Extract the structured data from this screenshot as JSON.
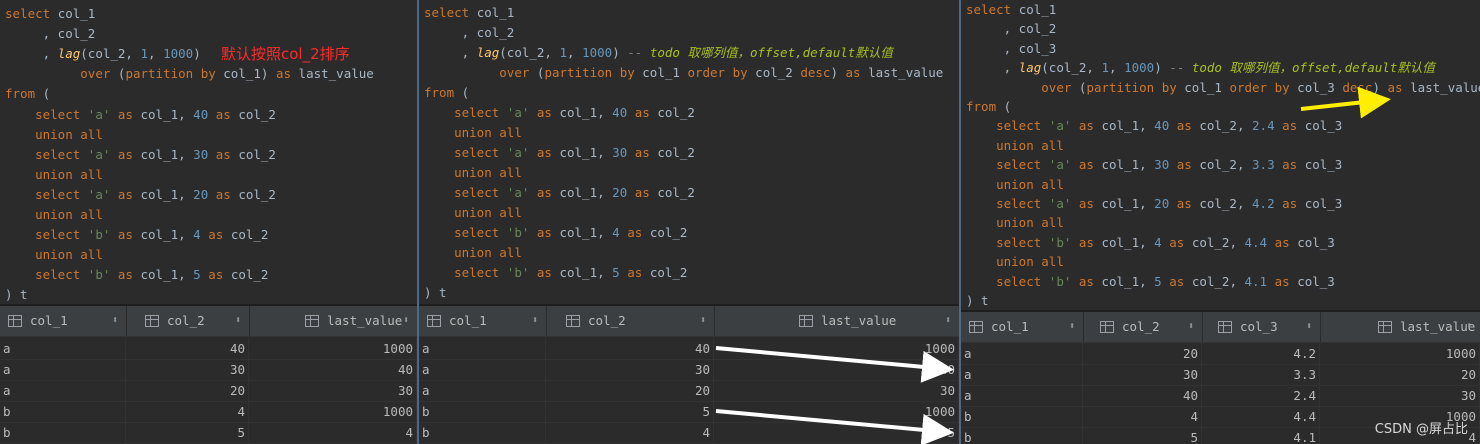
{
  "panels": [
    {
      "code": [
        [
          [
            "kw",
            "select "
          ],
          [
            "t",
            "col_1"
          ]
        ],
        [
          [
            "t",
            "     , col_2"
          ]
        ],
        [
          [
            "t",
            "     , "
          ],
          [
            "fn",
            "lag"
          ],
          [
            "t",
            "(col_2, "
          ],
          [
            "num",
            "1"
          ],
          [
            "t",
            ", "
          ],
          [
            "num",
            "1000"
          ],
          [
            "t",
            ")"
          ]
        ],
        [
          [
            "t",
            "          "
          ],
          [
            "kw",
            "over "
          ],
          [
            "t",
            "("
          ],
          [
            "kw",
            "partition by "
          ],
          [
            "t",
            "col_1) "
          ],
          [
            "kw",
            "as "
          ],
          [
            "t",
            "last_value"
          ]
        ],
        [
          [
            "kw",
            "from "
          ],
          [
            "t",
            "("
          ]
        ],
        [
          [
            "t",
            "    "
          ],
          [
            "kw",
            "select "
          ],
          [
            "str",
            "'a' "
          ],
          [
            "kw",
            "as "
          ],
          [
            "t",
            "col_1, "
          ],
          [
            "num",
            "40 "
          ],
          [
            "kw",
            "as "
          ],
          [
            "t",
            "col_2"
          ]
        ],
        [
          [
            "t",
            "    "
          ],
          [
            "kw",
            "union all"
          ]
        ],
        [
          [
            "t",
            "    "
          ],
          [
            "kw",
            "select "
          ],
          [
            "str",
            "'a' "
          ],
          [
            "kw",
            "as "
          ],
          [
            "t",
            "col_1, "
          ],
          [
            "num",
            "30 "
          ],
          [
            "kw",
            "as "
          ],
          [
            "t",
            "col_2"
          ]
        ],
        [
          [
            "t",
            "    "
          ],
          [
            "kw",
            "union all"
          ]
        ],
        [
          [
            "t",
            "    "
          ],
          [
            "kw",
            "select "
          ],
          [
            "str",
            "'a' "
          ],
          [
            "kw",
            "as "
          ],
          [
            "t",
            "col_1, "
          ],
          [
            "num",
            "20 "
          ],
          [
            "kw",
            "as "
          ],
          [
            "t",
            "col_2"
          ]
        ],
        [
          [
            "t",
            "    "
          ],
          [
            "kw",
            "union all"
          ]
        ],
        [
          [
            "t",
            "    "
          ],
          [
            "kw",
            "select "
          ],
          [
            "str",
            "'b' "
          ],
          [
            "kw",
            "as "
          ],
          [
            "t",
            "col_1, "
          ],
          [
            "num",
            "4 "
          ],
          [
            "kw",
            "as "
          ],
          [
            "t",
            "col_2"
          ]
        ],
        [
          [
            "t",
            "    "
          ],
          [
            "kw",
            "union all"
          ]
        ],
        [
          [
            "t",
            "    "
          ],
          [
            "kw",
            "select "
          ],
          [
            "str",
            "'b' "
          ],
          [
            "kw",
            "as "
          ],
          [
            "t",
            "col_1, "
          ],
          [
            "num",
            "5 "
          ],
          [
            "kw",
            "as "
          ],
          [
            "t",
            "col_2"
          ]
        ],
        [
          [
            "t",
            ") t"
          ]
        ]
      ],
      "note": "默认按照col_2排序",
      "grid": {
        "columns": [
          "col_1",
          "col_2",
          "last_value"
        ],
        "rows": [
          [
            "a",
            "40",
            "1000"
          ],
          [
            "a",
            "30",
            "40"
          ],
          [
            "a",
            "20",
            "30"
          ],
          [
            "b",
            "4",
            "1000"
          ],
          [
            "b",
            "5",
            "4"
          ]
        ]
      }
    },
    {
      "code": [
        [
          [
            "kw",
            "select "
          ],
          [
            "t",
            "col_1"
          ]
        ],
        [
          [
            "t",
            "     , col_2"
          ]
        ],
        [
          [
            "t",
            "     , "
          ],
          [
            "fn",
            "lag"
          ],
          [
            "t",
            "(col_2, "
          ],
          [
            "num",
            "1"
          ],
          [
            "t",
            ", "
          ],
          [
            "num",
            "1000"
          ],
          [
            "t",
            ") "
          ],
          [
            "cmt",
            "-- "
          ],
          [
            "todo",
            "todo 取哪列值，offset,default默认值"
          ]
        ],
        [
          [
            "t",
            "          "
          ],
          [
            "kw",
            "over "
          ],
          [
            "t",
            "("
          ],
          [
            "kw",
            "partition by "
          ],
          [
            "t",
            "col_1 "
          ],
          [
            "kw",
            "order by "
          ],
          [
            "t",
            "col_2 "
          ],
          [
            "kw",
            "desc"
          ],
          [
            "t",
            ") "
          ],
          [
            "kw",
            "as "
          ],
          [
            "t",
            "last_value"
          ]
        ],
        [
          [
            "kw",
            "from "
          ],
          [
            "t",
            "("
          ]
        ],
        [
          [
            "t",
            "    "
          ],
          [
            "kw",
            "select "
          ],
          [
            "str",
            "'a' "
          ],
          [
            "kw",
            "as "
          ],
          [
            "t",
            "col_1, "
          ],
          [
            "num",
            "40 "
          ],
          [
            "kw",
            "as "
          ],
          [
            "t",
            "col_2"
          ]
        ],
        [
          [
            "t",
            "    "
          ],
          [
            "kw",
            "union all"
          ]
        ],
        [
          [
            "t",
            "    "
          ],
          [
            "kw",
            "select "
          ],
          [
            "str",
            "'a' "
          ],
          [
            "kw",
            "as "
          ],
          [
            "t",
            "col_1, "
          ],
          [
            "num",
            "30 "
          ],
          [
            "kw",
            "as "
          ],
          [
            "t",
            "col_2"
          ]
        ],
        [
          [
            "t",
            "    "
          ],
          [
            "kw",
            "union all"
          ]
        ],
        [
          [
            "t",
            "    "
          ],
          [
            "kw",
            "select "
          ],
          [
            "str",
            "'a' "
          ],
          [
            "kw",
            "as "
          ],
          [
            "t",
            "col_1, "
          ],
          [
            "num",
            "20 "
          ],
          [
            "kw",
            "as "
          ],
          [
            "t",
            "col_2"
          ]
        ],
        [
          [
            "t",
            "    "
          ],
          [
            "kw",
            "union all"
          ]
        ],
        [
          [
            "t",
            "    "
          ],
          [
            "kw",
            "select "
          ],
          [
            "str",
            "'b' "
          ],
          [
            "kw",
            "as "
          ],
          [
            "t",
            "col_1, "
          ],
          [
            "num",
            "4 "
          ],
          [
            "kw",
            "as "
          ],
          [
            "t",
            "col_2"
          ]
        ],
        [
          [
            "t",
            "    "
          ],
          [
            "kw",
            "union all"
          ]
        ],
        [
          [
            "t",
            "    "
          ],
          [
            "kw",
            "select "
          ],
          [
            "str",
            "'b' "
          ],
          [
            "kw",
            "as "
          ],
          [
            "t",
            "col_1, "
          ],
          [
            "num",
            "5 "
          ],
          [
            "kw",
            "as "
          ],
          [
            "t",
            "col_2"
          ]
        ],
        [
          [
            "t",
            ") t"
          ]
        ]
      ],
      "grid": {
        "columns": [
          "col_1",
          "col_2",
          "last_value"
        ],
        "rows": [
          [
            "a",
            "40",
            "1000"
          ],
          [
            "a",
            "30",
            "40"
          ],
          [
            "a",
            "20",
            "30"
          ],
          [
            "b",
            "5",
            "1000"
          ],
          [
            "b",
            "4",
            "5"
          ]
        ]
      }
    },
    {
      "code": [
        [
          [
            "kw",
            "select "
          ],
          [
            "t",
            "col_1"
          ]
        ],
        [
          [
            "t",
            "     , col_2"
          ]
        ],
        [
          [
            "t",
            "     , col_3"
          ]
        ],
        [
          [
            "t",
            "     , "
          ],
          [
            "fn",
            "lag"
          ],
          [
            "t",
            "(col_2, "
          ],
          [
            "num",
            "1"
          ],
          [
            "t",
            ", "
          ],
          [
            "num",
            "1000"
          ],
          [
            "t",
            ") "
          ],
          [
            "cmt",
            "-- "
          ],
          [
            "todo",
            "todo 取哪列值，offset,default默认值"
          ]
        ],
        [
          [
            "t",
            "          "
          ],
          [
            "kw",
            "over "
          ],
          [
            "t",
            "("
          ],
          [
            "kw",
            "partition by "
          ],
          [
            "t",
            "col_1 "
          ],
          [
            "kw",
            "order by "
          ],
          [
            "t",
            "col_3 "
          ],
          [
            "kw",
            "desc"
          ],
          [
            "t",
            ") "
          ],
          [
            "kw",
            "as "
          ],
          [
            "t",
            "last_value"
          ]
        ],
        [
          [
            "kw",
            "from "
          ],
          [
            "t",
            "("
          ]
        ],
        [
          [
            "t",
            "    "
          ],
          [
            "kw",
            "select "
          ],
          [
            "str",
            "'a' "
          ],
          [
            "kw",
            "as "
          ],
          [
            "t",
            "col_1, "
          ],
          [
            "num",
            "40 "
          ],
          [
            "kw",
            "as "
          ],
          [
            "t",
            "col_2, "
          ],
          [
            "num",
            "2.4 "
          ],
          [
            "kw",
            "as "
          ],
          [
            "t",
            "col_3"
          ]
        ],
        [
          [
            "t",
            "    "
          ],
          [
            "kw",
            "union all"
          ]
        ],
        [
          [
            "t",
            "    "
          ],
          [
            "kw",
            "select "
          ],
          [
            "str",
            "'a' "
          ],
          [
            "kw",
            "as "
          ],
          [
            "t",
            "col_1, "
          ],
          [
            "num",
            "30 "
          ],
          [
            "kw",
            "as "
          ],
          [
            "t",
            "col_2, "
          ],
          [
            "num",
            "3.3 "
          ],
          [
            "kw",
            "as "
          ],
          [
            "t",
            "col_3"
          ]
        ],
        [
          [
            "t",
            "    "
          ],
          [
            "kw",
            "union all"
          ]
        ],
        [
          [
            "t",
            "    "
          ],
          [
            "kw",
            "select "
          ],
          [
            "str",
            "'a' "
          ],
          [
            "kw",
            "as "
          ],
          [
            "t",
            "col_1, "
          ],
          [
            "num",
            "20 "
          ],
          [
            "kw",
            "as "
          ],
          [
            "t",
            "col_2, "
          ],
          [
            "num",
            "4.2 "
          ],
          [
            "kw",
            "as "
          ],
          [
            "t",
            "col_3"
          ]
        ],
        [
          [
            "t",
            "    "
          ],
          [
            "kw",
            "union all"
          ]
        ],
        [
          [
            "t",
            "    "
          ],
          [
            "kw",
            "select "
          ],
          [
            "str",
            "'b' "
          ],
          [
            "kw",
            "as "
          ],
          [
            "t",
            "col_1, "
          ],
          [
            "num",
            "4 "
          ],
          [
            "kw",
            "as "
          ],
          [
            "t",
            "col_2, "
          ],
          [
            "num",
            "4.4 "
          ],
          [
            "kw",
            "as "
          ],
          [
            "t",
            "col_3"
          ]
        ],
        [
          [
            "t",
            "    "
          ],
          [
            "kw",
            "union all"
          ]
        ],
        [
          [
            "t",
            "    "
          ],
          [
            "kw",
            "select "
          ],
          [
            "str",
            "'b' "
          ],
          [
            "kw",
            "as "
          ],
          [
            "t",
            "col_1, "
          ],
          [
            "num",
            "5 "
          ],
          [
            "kw",
            "as "
          ],
          [
            "t",
            "col_2, "
          ],
          [
            "num",
            "4.1 "
          ],
          [
            "kw",
            "as "
          ],
          [
            "t",
            "col_3"
          ]
        ],
        [
          [
            "t",
            ") t"
          ]
        ]
      ],
      "grid": {
        "columns": [
          "col_1",
          "col_2",
          "col_3",
          "last_value"
        ],
        "rows": [
          [
            "a",
            "20",
            "4.2",
            "1000"
          ],
          [
            "a",
            "30",
            "3.3",
            "20"
          ],
          [
            "a",
            "40",
            "2.4",
            "30"
          ],
          [
            "b",
            "4",
            "4.4",
            "1000"
          ],
          [
            "b",
            "5",
            "4.1",
            "4"
          ]
        ]
      }
    }
  ],
  "watermark": "CSDN @屏占比",
  "colors": {
    "keyword": "#cc7832",
    "string": "#6a8759",
    "number": "#6897bb",
    "function": "#ffc66d",
    "todo": "#a8c023",
    "note": "#ff2a2a",
    "arrow_white": "#ffffff",
    "arrow_yellow": "#ffee00"
  }
}
